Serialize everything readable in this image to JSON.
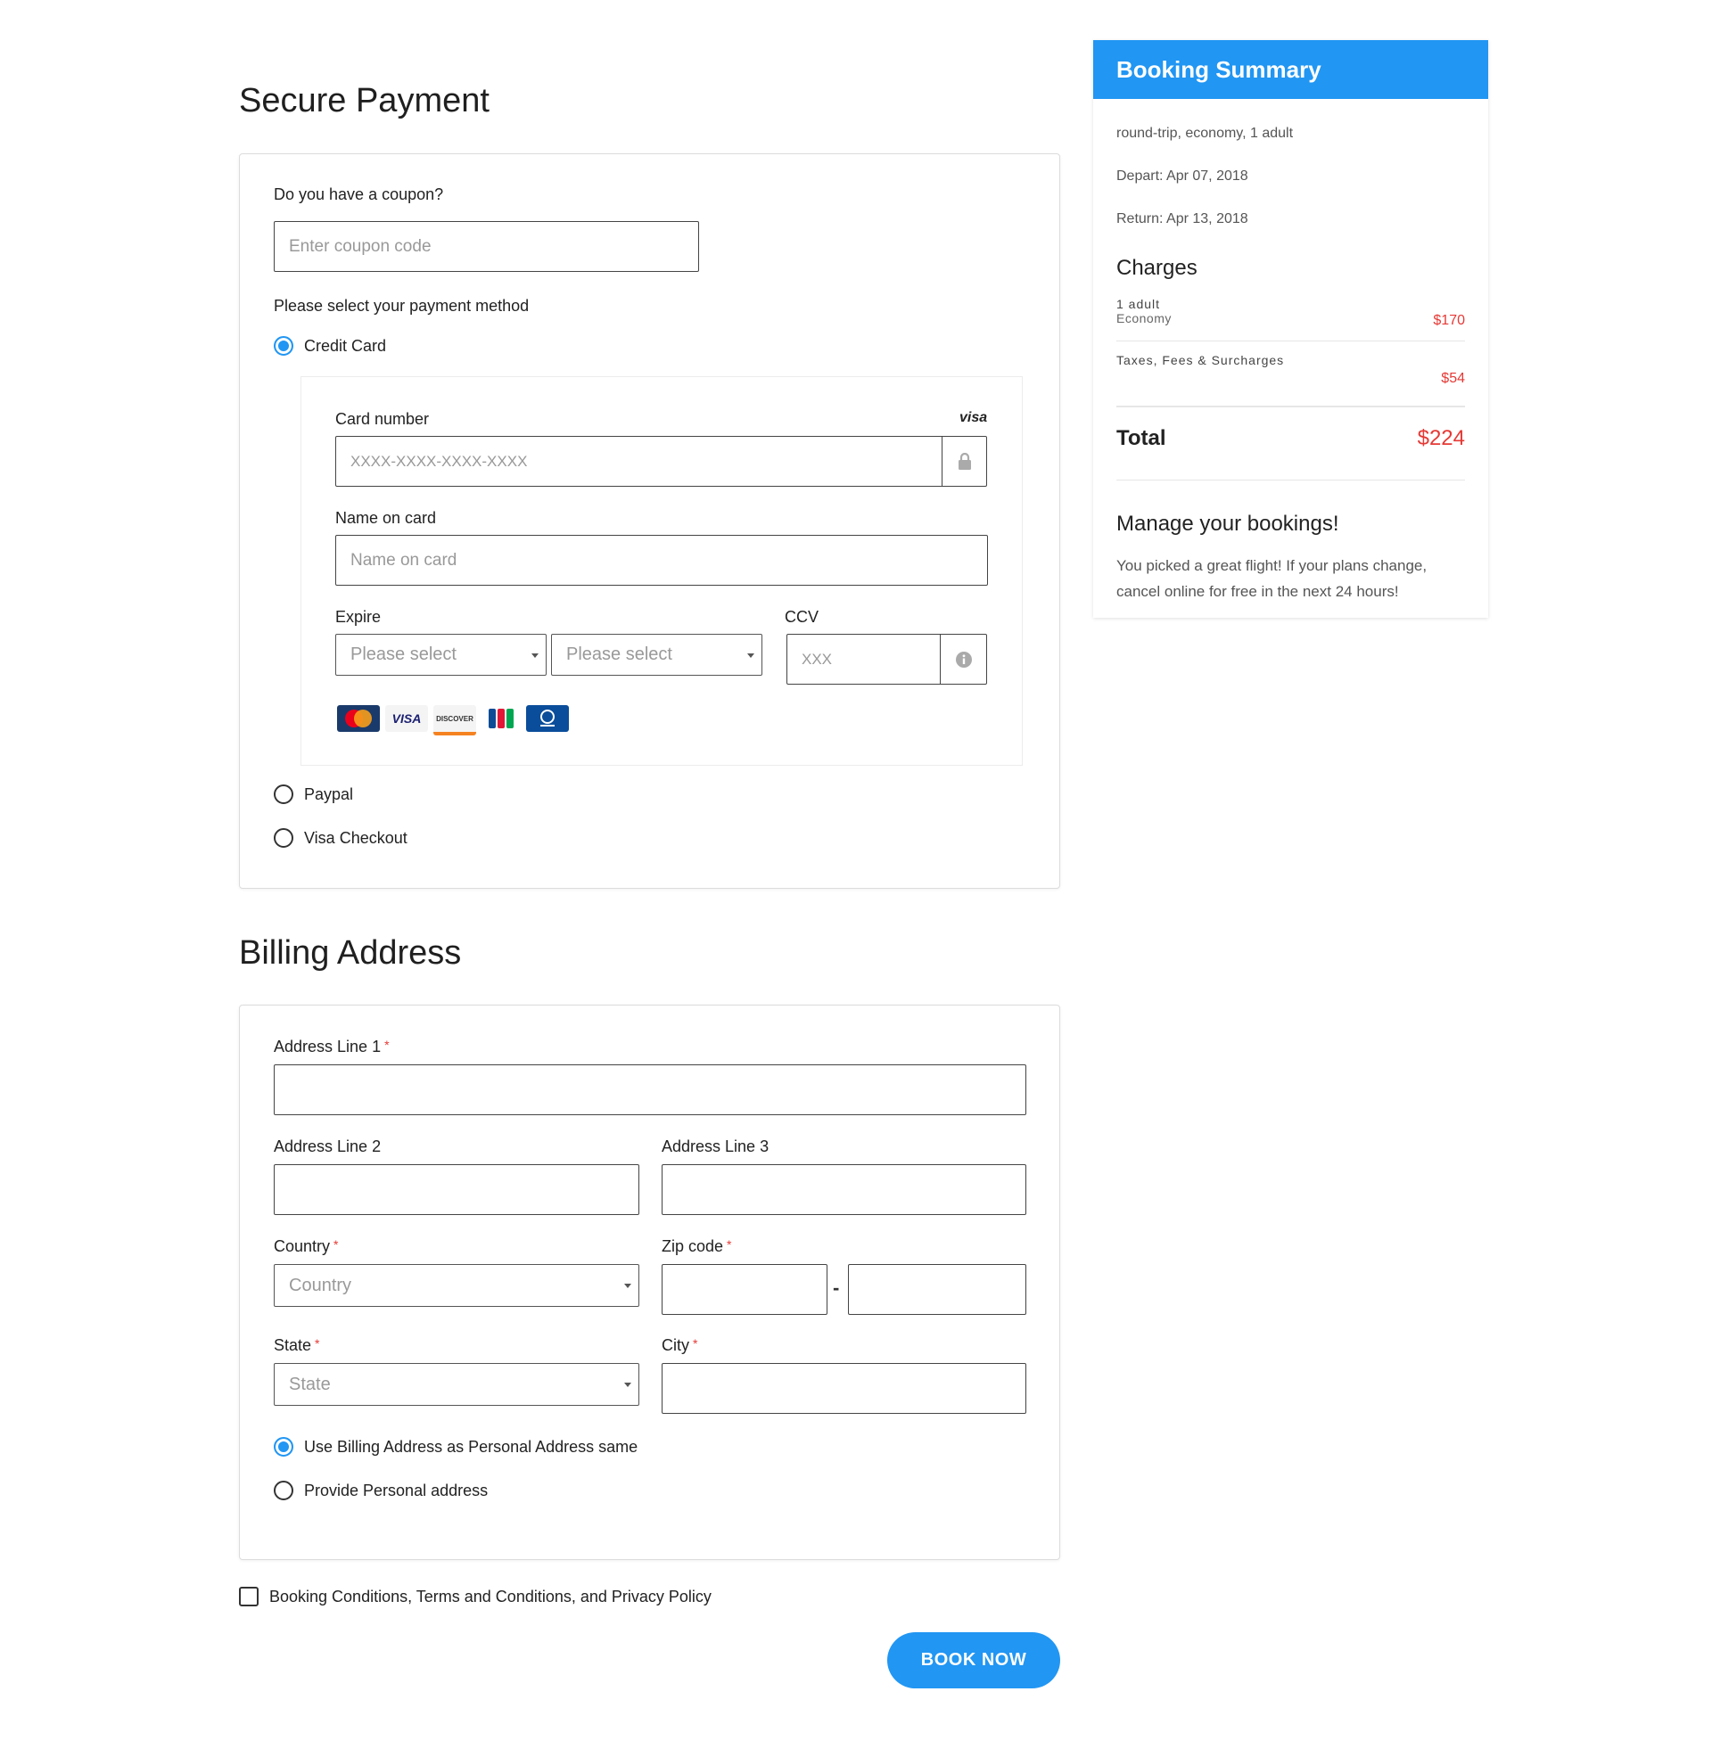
{
  "payment": {
    "title": "Secure Payment",
    "coupon_question": "Do you have a coupon?",
    "coupon_placeholder": "Enter coupon code",
    "method_prompt": "Please select your payment method",
    "methods": [
      {
        "label": "Credit Card",
        "selected": true
      },
      {
        "label": "Paypal",
        "selected": false
      },
      {
        "label": "Visa Checkout",
        "selected": false
      }
    ],
    "card": {
      "card_number_label": "Card number",
      "brand_hint": "visa",
      "card_number_placeholder": "XXXX-XXXX-XXXX-XXXX",
      "name_label": "Name on card",
      "name_placeholder": "Name on card",
      "expire_label": "Expire",
      "month_placeholder": "Please select",
      "year_placeholder": "Please select",
      "ccv_label": "CCV",
      "ccv_placeholder": "XXX",
      "accepted_cards": [
        "MasterCard",
        "VISA",
        "DISCOVER",
        "JCB",
        "Diners Club"
      ]
    }
  },
  "billing": {
    "title": "Billing Address",
    "address1_label": "Address Line 1",
    "address2_label": "Address Line 2",
    "address3_label": "Address Line 3",
    "country_label": "Country",
    "country_placeholder": "Country",
    "zip_label": "Zip code",
    "zip_separator": "-",
    "state_label": "State",
    "state_placeholder": "State",
    "city_label": "City",
    "required_mark": "*",
    "address_options": [
      {
        "label": "Use Billing Address as Personal Address same",
        "selected": true
      },
      {
        "label": "Provide Personal address",
        "selected": false
      }
    ]
  },
  "terms": {
    "label": "Booking Conditions, Terms and Conditions, and Privacy Policy",
    "checked": false
  },
  "book_button": "BOOK NOW",
  "summary": {
    "title": "Booking Summary",
    "trip": "round-trip, economy, 1 adult",
    "depart": "Depart: Apr 07, 2018",
    "return": "Return: Apr 13, 2018",
    "charges_title": "Charges",
    "charges": [
      {
        "label": "1 adult",
        "sub": "Economy",
        "amount": "$170"
      },
      {
        "label": "Taxes, Fees & Surcharges",
        "sub": "",
        "amount": "$54"
      }
    ],
    "total_label": "Total",
    "total_amount": "$224",
    "manage_title": "Manage your bookings!",
    "manage_text": "You picked a great flight! If your plans change, cancel online for free in the next 24 hours!"
  },
  "colors": {
    "accent": "#2196f3",
    "price": "#e53935"
  }
}
